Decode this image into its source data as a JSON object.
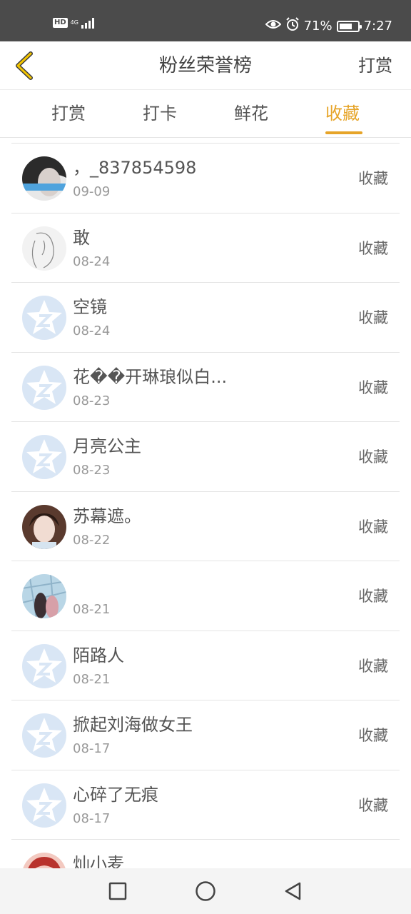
{
  "status_bar": {
    "hd": "HD",
    "network": "4G",
    "network_sub": "46",
    "battery_percent": "71%",
    "battery_level": 0.71,
    "time": "7:27",
    "icons": [
      "eye-icon",
      "alarm-icon",
      "battery-icon"
    ]
  },
  "header": {
    "back_icon": "chevron-left-icon",
    "title": "粉丝荣誉榜",
    "action_label": "打赏",
    "accent_color": "#e6a428"
  },
  "tabs": [
    {
      "label": "打赏",
      "active": false
    },
    {
      "label": "打卡",
      "active": false
    },
    {
      "label": "鲜花",
      "active": false
    },
    {
      "label": "收藏",
      "active": true
    }
  ],
  "list": {
    "items": [
      {
        "name": "，_837854598",
        "date": "09-09",
        "action": "收藏",
        "avatar": "photo-avatar-1"
      },
      {
        "name": "敢",
        "date": "08-24",
        "action": "收藏",
        "avatar": "sketch-avatar"
      },
      {
        "name": "空镜",
        "date": "08-24",
        "action": "收藏",
        "avatar": "default-avatar"
      },
      {
        "name": "花��开琳琅似白...",
        "date": "08-23",
        "action": "收藏",
        "avatar": "default-avatar"
      },
      {
        "name": "月亮公主",
        "date": "08-23",
        "action": "收藏",
        "avatar": "default-avatar"
      },
      {
        "name": "苏幕遮。",
        "date": "08-22",
        "action": "收藏",
        "avatar": "photo-avatar-2"
      },
      {
        "name": "",
        "date": "08-21",
        "action": "收藏",
        "avatar": "photo-avatar-3"
      },
      {
        "name": "陌路人",
        "date": "08-21",
        "action": "收藏",
        "avatar": "default-avatar"
      },
      {
        "name": "掀起刘海做女王",
        "date": "08-17",
        "action": "收藏",
        "avatar": "default-avatar"
      },
      {
        "name": "心碎了无痕",
        "date": "08-17",
        "action": "收藏",
        "avatar": "default-avatar"
      },
      {
        "name": "灿小麦",
        "date": "",
        "action": "",
        "avatar": "photo-avatar-4"
      }
    ]
  },
  "nav_bar": {
    "icons": [
      "square-recents-icon",
      "circle-home-icon",
      "triangle-back-icon"
    ]
  }
}
